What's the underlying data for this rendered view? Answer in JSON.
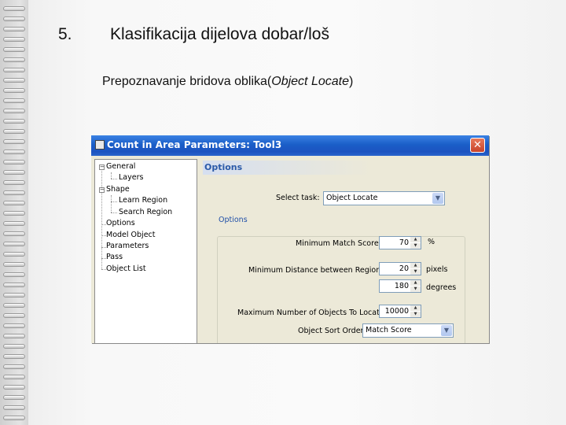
{
  "slide": {
    "number": "5.",
    "title": "Klasifikacija dijelova dobar/loš",
    "subtitle_prefix": "Prepoznavanje bridova oblika(",
    "subtitle_italic": "Object Locate",
    "subtitle_suffix": ")"
  },
  "dialog": {
    "title": "Count in Area Parameters: Tool3",
    "close_symbol": "✕",
    "tree": [
      {
        "label": "General",
        "expander": "−"
      },
      {
        "label": "Layers"
      },
      {
        "label": "Shape",
        "expander": "−"
      },
      {
        "label": "Learn Region"
      },
      {
        "label": "Search Region"
      },
      {
        "label": "Options"
      },
      {
        "label": "Model Object"
      },
      {
        "label": "Parameters"
      },
      {
        "label": "Pass"
      },
      {
        "label": "Object List"
      }
    ],
    "panel": {
      "header": "Options",
      "select_task_label": "Select task:",
      "select_task_value": "Object Locate",
      "group_label": "Options",
      "min_match_score_label": "Minimum Match Score",
      "min_match_score_value": "70",
      "min_match_score_unit": "%",
      "min_distance_label": "Minimum Distance between Regions",
      "min_distance_value": "20",
      "min_distance_unit": "pixels",
      "degrees_value": "180",
      "degrees_unit": "degrees",
      "max_objects_label": "Maximum Number of Objects To Locate",
      "max_objects_value": "10000",
      "sort_order_label": "Object Sort Order",
      "sort_order_value": "Match Score"
    }
  }
}
